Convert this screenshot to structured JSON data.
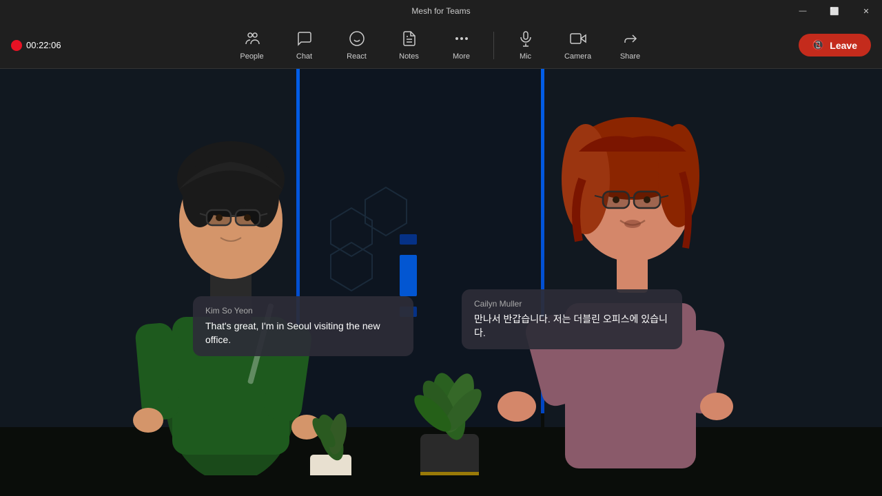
{
  "app": {
    "title": "Mesh for Teams"
  },
  "window_controls": {
    "minimize": "—",
    "maximize": "⬜",
    "close": "✕"
  },
  "recording": {
    "time": "00:22:06"
  },
  "toolbar": {
    "buttons": [
      {
        "id": "people",
        "label": "People",
        "icon": "people"
      },
      {
        "id": "chat",
        "label": "Chat",
        "icon": "chat"
      },
      {
        "id": "react",
        "label": "React",
        "icon": "react"
      },
      {
        "id": "notes",
        "label": "Notes",
        "icon": "notes"
      },
      {
        "id": "more",
        "label": "More",
        "icon": "more"
      },
      {
        "id": "mic",
        "label": "Mic",
        "icon": "mic"
      },
      {
        "id": "camera",
        "label": "Camera",
        "icon": "camera"
      },
      {
        "id": "share",
        "label": "Share",
        "icon": "share"
      }
    ],
    "leave_label": "Leave"
  },
  "bubbles": {
    "left": {
      "name": "Kim So Yeon",
      "text": "That's great, I'm in Seoul visiting the new office."
    },
    "right": {
      "name": "Cailyn Muller",
      "text": "만나서 반갑습니다. 저는 더블린 오피스에 있습니다."
    }
  }
}
